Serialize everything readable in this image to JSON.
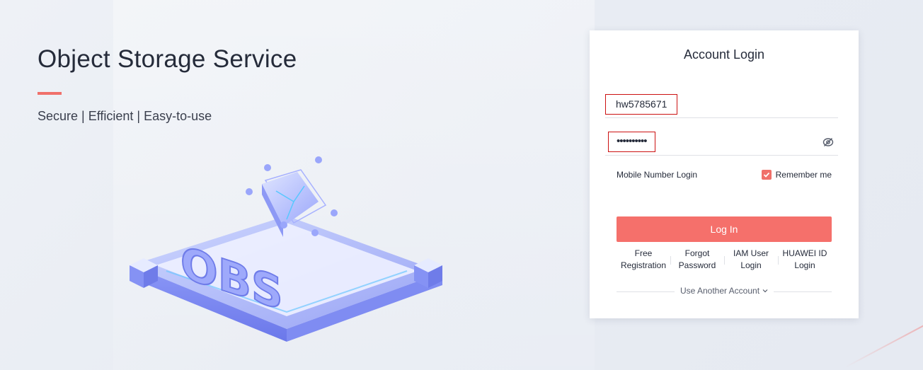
{
  "hero": {
    "title": "Object Storage Service",
    "subtitle": "Secure | Efficient | Easy-to-use",
    "accent_color": "#f0706a"
  },
  "login": {
    "title": "Account Login",
    "username_value": "hw5785671",
    "password_value": "••••••••••",
    "password_toggle_icon": "eye-hidden-icon",
    "mobile_login_label": "Mobile Number Login",
    "remember_me_label": "Remember me",
    "remember_me_checked": true,
    "login_button_label": "Log In",
    "button_color": "#f5706b",
    "links": [
      {
        "line1": "Free",
        "line2": "Registration"
      },
      {
        "line1": "Forgot",
        "line2": "Password"
      },
      {
        "line1": "IAM User",
        "line2": "Login"
      },
      {
        "line1": "HUAWEI ID",
        "line2": "Login"
      }
    ],
    "another_account_label": "Use Another Account"
  }
}
